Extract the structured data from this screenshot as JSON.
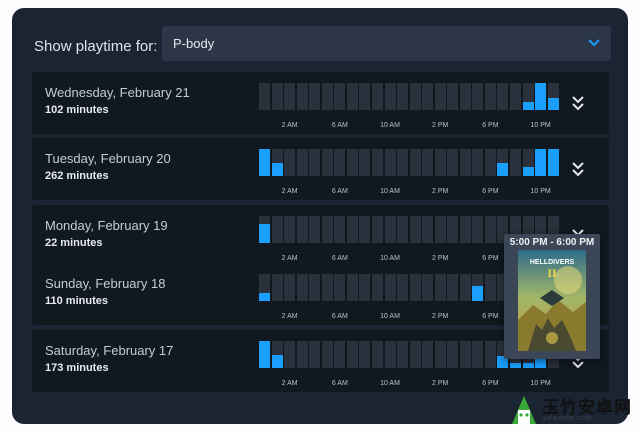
{
  "selector": {
    "label": "Show playtime for:",
    "value": "P-body"
  },
  "hour_ticks": [
    "2 AM",
    "6 AM",
    "10 AM",
    "2 PM",
    "6 PM",
    "10 PM"
  ],
  "days": [
    {
      "date": "Wednesday, February 21",
      "minutes": "102 minutes",
      "hourly_fraction": [
        0,
        0,
        0,
        0,
        0,
        0,
        0,
        0,
        0,
        0,
        0,
        0,
        0,
        0,
        0,
        0,
        0,
        0,
        0,
        0,
        0,
        0.3,
        1,
        0.45
      ]
    },
    {
      "date": "Tuesday, February 20",
      "minutes": "262 minutes",
      "hourly_fraction": [
        1,
        0.5,
        0,
        0,
        0,
        0,
        0,
        0,
        0,
        0,
        0,
        0,
        0,
        0,
        0,
        0,
        0,
        0,
        0,
        0.5,
        0,
        0.35,
        1,
        1
      ]
    },
    {
      "date": "Monday, February 19",
      "minutes": "22 minutes",
      "hourly_fraction": [
        0.7,
        0,
        0,
        0,
        0,
        0,
        0,
        0,
        0,
        0,
        0,
        0,
        0,
        0,
        0,
        0,
        0,
        0,
        0,
        0,
        0,
        0,
        0,
        0
      ]
    },
    {
      "date": "Sunday, February 18",
      "minutes": "110 minutes",
      "hourly_fraction": [
        0.3,
        0,
        0,
        0,
        0,
        0,
        0,
        0,
        0,
        0,
        0,
        0,
        0,
        0,
        0,
        0,
        0,
        0.55,
        0,
        0,
        0,
        0,
        0,
        0
      ]
    },
    {
      "date": "Saturday, February 17",
      "minutes": "173 minutes",
      "hourly_fraction": [
        1,
        0.5,
        0,
        0,
        0,
        0,
        0,
        0,
        0,
        0,
        0,
        0,
        0,
        0,
        0,
        0,
        0,
        0,
        0,
        0.45,
        0.2,
        0.2,
        0.55,
        0
      ]
    }
  ],
  "tooltip": {
    "time_range": "5:00 PM - 6:00 PM",
    "game_art_text": "HELLDIVERS",
    "game_art_numeral": "II"
  },
  "watermark": {
    "title": "玉竹安卓网",
    "url": "yzlanshe.com"
  },
  "colors": {
    "accent": "#1a9fff",
    "panel_bg": "#1b2433",
    "row_bg": "#101820",
    "empty_bar": "#2a313c"
  }
}
